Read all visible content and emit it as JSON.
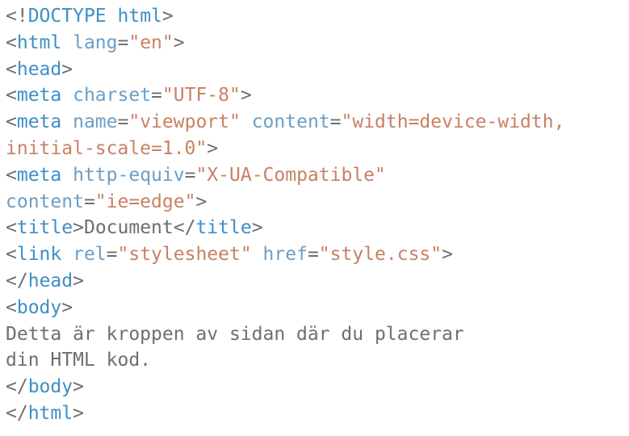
{
  "editor": {
    "lines": [
      [
        {
          "t": "punct",
          "v": "<!"
        },
        {
          "t": "tag",
          "v": "DOCTYPE"
        },
        {
          "t": "punct",
          "v": " "
        },
        {
          "t": "tag",
          "v": "html"
        },
        {
          "t": "punct",
          "v": ">"
        }
      ],
      [
        {
          "t": "punct",
          "v": "<"
        },
        {
          "t": "tag",
          "v": "html"
        },
        {
          "t": "punct",
          "v": " "
        },
        {
          "t": "attr",
          "v": "lang"
        },
        {
          "t": "punct",
          "v": "="
        },
        {
          "t": "val",
          "v": "\"en\""
        },
        {
          "t": "punct",
          "v": ">"
        }
      ],
      [
        {
          "t": "punct",
          "v": "<"
        },
        {
          "t": "tag",
          "v": "head"
        },
        {
          "t": "punct",
          "v": ">"
        }
      ],
      [
        {
          "t": "punct",
          "v": "<"
        },
        {
          "t": "tag",
          "v": "meta"
        },
        {
          "t": "punct",
          "v": " "
        },
        {
          "t": "attr",
          "v": "charset"
        },
        {
          "t": "punct",
          "v": "="
        },
        {
          "t": "val",
          "v": "\"UTF-8\""
        },
        {
          "t": "punct",
          "v": ">"
        }
      ],
      [
        {
          "t": "punct",
          "v": "<"
        },
        {
          "t": "tag",
          "v": "meta"
        },
        {
          "t": "punct",
          "v": " "
        },
        {
          "t": "attr",
          "v": "name"
        },
        {
          "t": "punct",
          "v": "="
        },
        {
          "t": "val",
          "v": "\"viewport\""
        },
        {
          "t": "punct",
          "v": " "
        },
        {
          "t": "attr",
          "v": "content"
        },
        {
          "t": "punct",
          "v": "="
        },
        {
          "t": "val",
          "v": "\"width=device-width,"
        }
      ],
      [
        {
          "t": "val",
          "v": "initial-scale=1.0\""
        },
        {
          "t": "punct",
          "v": ">"
        }
      ],
      [
        {
          "t": "punct",
          "v": "<"
        },
        {
          "t": "tag",
          "v": "meta"
        },
        {
          "t": "punct",
          "v": " "
        },
        {
          "t": "attr",
          "v": "http-equiv"
        },
        {
          "t": "punct",
          "v": "="
        },
        {
          "t": "val",
          "v": "\"X-UA-Compatible\""
        }
      ],
      [
        {
          "t": "attr",
          "v": "content"
        },
        {
          "t": "punct",
          "v": "="
        },
        {
          "t": "val",
          "v": "\"ie=edge\""
        },
        {
          "t": "punct",
          "v": ">"
        }
      ],
      [
        {
          "t": "punct",
          "v": "<"
        },
        {
          "t": "tag",
          "v": "title"
        },
        {
          "t": "punct",
          "v": ">"
        },
        {
          "t": "text",
          "v": "Document"
        },
        {
          "t": "punct",
          "v": "</"
        },
        {
          "t": "tag",
          "v": "title"
        },
        {
          "t": "punct",
          "v": ">"
        }
      ],
      [
        {
          "t": "punct",
          "v": "<"
        },
        {
          "t": "tag",
          "v": "link"
        },
        {
          "t": "punct",
          "v": " "
        },
        {
          "t": "attr",
          "v": "rel"
        },
        {
          "t": "punct",
          "v": "="
        },
        {
          "t": "val",
          "v": "\"stylesheet\""
        },
        {
          "t": "punct",
          "v": " "
        },
        {
          "t": "attr",
          "v": "href"
        },
        {
          "t": "punct",
          "v": "="
        },
        {
          "t": "val",
          "v": "\"style.css\""
        },
        {
          "t": "punct",
          "v": ">"
        }
      ],
      [
        {
          "t": "punct",
          "v": "</"
        },
        {
          "t": "tag",
          "v": "head"
        },
        {
          "t": "punct",
          "v": ">"
        }
      ],
      [
        {
          "t": "punct",
          "v": "<"
        },
        {
          "t": "tag",
          "v": "body"
        },
        {
          "t": "punct",
          "v": ">"
        }
      ],
      [
        {
          "t": "text",
          "v": "Detta är kroppen av sidan där du placerar"
        }
      ],
      [
        {
          "t": "text",
          "v": "din HTML kod."
        }
      ],
      [
        {
          "t": "punct",
          "v": "</"
        },
        {
          "t": "tag",
          "v": "body"
        },
        {
          "t": "punct",
          "v": ">"
        }
      ],
      [
        {
          "t": "punct",
          "v": "</"
        },
        {
          "t": "tag",
          "v": "html"
        },
        {
          "t": "punct",
          "v": ">"
        }
      ]
    ]
  },
  "colors": {
    "punctuation": "#6e6e6e",
    "tag": "#3d8fc6",
    "attribute": "#6c9ec4",
    "value": "#c88162",
    "text": "#6e6e6e",
    "background": "#ffffff"
  }
}
